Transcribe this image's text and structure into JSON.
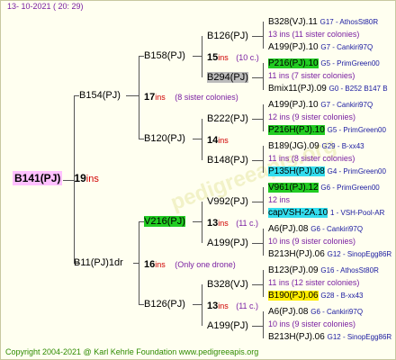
{
  "header": {
    "date": "13- 10-2021 ( 20: 29)"
  },
  "footer": {
    "copyright": "Copyright 2004-2021 @ Karl Kehrle Foundation    www.pedigreeapis.org"
  },
  "watermark": "pedigreeapis.org",
  "tree": {
    "root": {
      "name": "B141(PJ)",
      "ins": "19",
      "ins_label": "ins"
    },
    "g1": [
      {
        "name": "B154(PJ)",
        "ins": "17",
        "ins_label": "ins",
        "note": "(8 sister colonies)"
      },
      {
        "name": "B11(PJ)1dr",
        "ins": "16",
        "ins_label": "ins",
        "note": "(Only one drone)"
      }
    ],
    "g2": [
      {
        "name": "B158(PJ)",
        "ins": "15",
        "ins_label": "ins",
        "note": "(10 c.)"
      },
      {
        "name": "B120(PJ)",
        "ins": "14",
        "ins_label": "ins"
      },
      {
        "name": "V216(PJ)",
        "ins": "13",
        "ins_label": "ins",
        "note": "(11 c.)"
      },
      {
        "name": "B126(PJ)",
        "ins": "13",
        "ins_label": "ins",
        "note": "(11 c.)"
      }
    ],
    "g3": [
      {
        "name": "B126(PJ)"
      },
      {
        "name": "B294(PJ)"
      },
      {
        "name": "B222(PJ)"
      },
      {
        "name": "B148(PJ)"
      },
      {
        "name": "V992(PJ)"
      },
      {
        "name": "A199(PJ)"
      },
      {
        "name": "B328(VJ)"
      },
      {
        "name": "A199(PJ)"
      }
    ],
    "g4": [
      {
        "top": "B328(VJ).11",
        "topr": "G17 - AthosSt80R",
        "mid": "13 ins (11 sister colonies)",
        "bot": "A199(PJ).10",
        "botr": "G7 - Cankiri97Q"
      },
      {
        "top": "P216(PJ).10",
        "topr": "G5 - PrimGreen00",
        "mid": "11 ins (7 sister colonies)",
        "bot": "Bmix11(PJ).09",
        "botr": "G0 - B252 B147 B"
      },
      {
        "top": "A199(PJ).10",
        "topr": "G7 - Cankiri97Q",
        "mid": "12 ins (9 sister colonies)",
        "bot": "P216H(PJ).10",
        "botr": "G5 - PrimGreen00"
      },
      {
        "top": "B189(JG).09",
        "topr": "G29 - B-xx43",
        "mid": "11 ins (8 sister colonies)",
        "bot": "P135H(PJ).08",
        "botr": "G4 - PrimGreen00"
      },
      {
        "top": "V961(PJ).12",
        "topr": "G6 - PrimGreen00",
        "mid": "12 ins",
        "bot": "capVSH-2A.10",
        "botr": "1 - VSH-Pool-AR"
      },
      {
        "top": "A6(PJ).08",
        "topr": "G6 - Cankiri97Q",
        "mid": "10 ins (9 sister colonies)",
        "bot": "B213H(PJ).06",
        "botr": "G12 - SinopEgg86R"
      },
      {
        "top": "B123(PJ).09",
        "topr": "G16 - AthosSt80R",
        "mid": "11 ins (12 sister colonies)",
        "bot": "B190(PJ).06",
        "botr": "G28 - B-xx43"
      },
      {
        "top": "A6(PJ).08",
        "topr": "G6 - Cankiri97Q",
        "mid": "10 ins (9 sister colonies)",
        "bot": "B213H(PJ).06",
        "botr": "G12 - SinopEgg86R"
      }
    ]
  },
  "colors": {
    "insect_red": "#d00000",
    "highlight_green": "#22cc22",
    "highlight_cyan": "#33ddee",
    "highlight_yellow": "#ffee00",
    "root_pink": "#ffc0ff"
  }
}
